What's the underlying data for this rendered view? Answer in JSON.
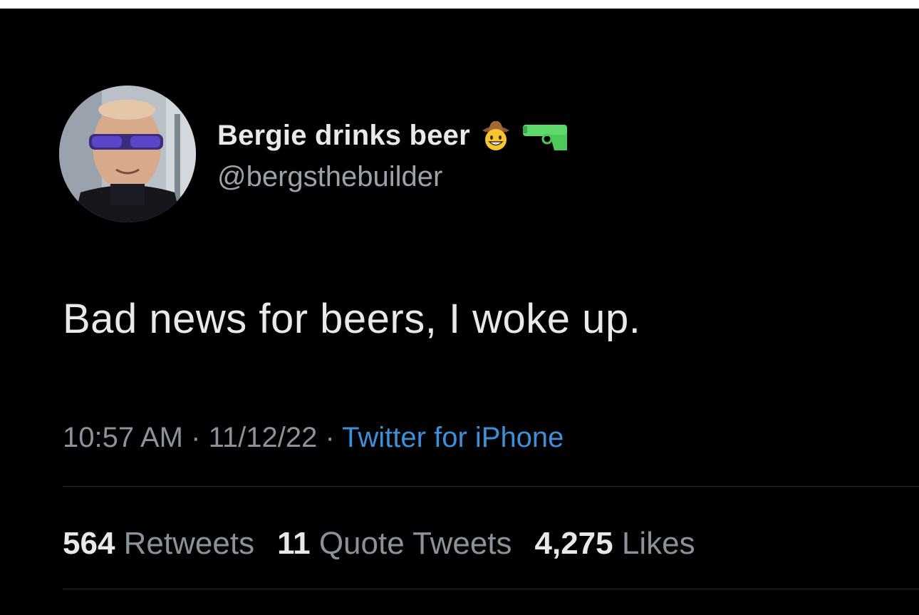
{
  "tweet": {
    "author": {
      "display_name": "Bergie drinks beer",
      "name_emojis": [
        "cowboy-hat-face-icon",
        "water-pistol-icon"
      ],
      "handle": "@bergsthebuilder"
    },
    "text": "Bad news for beers, I woke up.",
    "meta": {
      "time": "10:57 AM",
      "separator1": "·",
      "date": "11/12/22",
      "separator2": "·",
      "source": "Twitter for iPhone"
    },
    "stats": {
      "retweets_count": "564",
      "retweets_label": "Retweets",
      "quote_count": "11",
      "quote_label": "Quote Tweets",
      "likes_count": "4,275",
      "likes_label": "Likes"
    }
  },
  "colors": {
    "background": "#000000",
    "primary_text": "#e7e9ea",
    "secondary_text": "#8b9299",
    "link": "#3d8fd8",
    "divider": "#2a2d30"
  }
}
